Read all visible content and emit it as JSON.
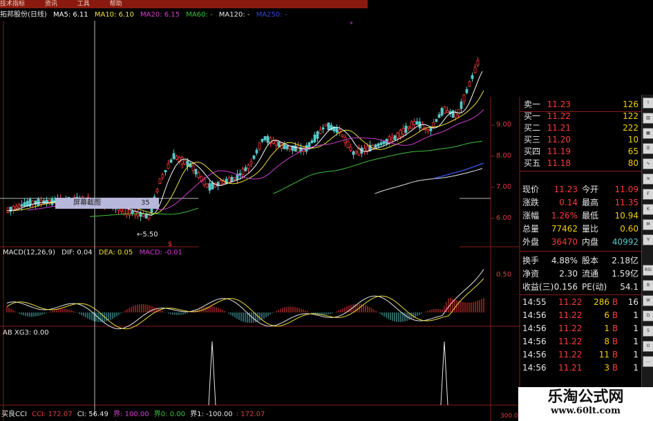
{
  "menu": [
    "技术指标",
    "资讯",
    "工具",
    "帮助"
  ],
  "header": {
    "stock": "拓邦股份(日线)",
    "ma5": "MA5: 6.11",
    "ma10": "MA10: 6.10",
    "ma20": "MA20: 6.15",
    "ma60": "MA60: -",
    "ma120": "MA120: -",
    "ma250": "MA250: -"
  },
  "colors": {
    "up": "#ff3a3a",
    "down": "#55c8c8",
    "ma5": "#ffffff",
    "ma10": "#f0e040",
    "ma20": "#d040d0",
    "ma60": "#40c040",
    "ma120": "#e8e8e8",
    "ma250": "#3048c8",
    "grid": "#8a1d1d"
  },
  "price_axis": [
    "9.00",
    "8.00",
    "7.00",
    "6.00"
  ],
  "macd_axis": [
    "0.50"
  ],
  "cci_axis": [
    "300.00"
  ],
  "low_marker": "5.50",
  "screenshot_tip": {
    "label": "屏幕截图",
    "value": "35"
  },
  "macd_header": {
    "name": "MACD(12,26,9)",
    "dif": "DIF: 0.04",
    "dea": "DEA: 0.05",
    "macd": "MACD: -0.01"
  },
  "xg_header": "AB XG3: 0.00",
  "cci_header": {
    "name": "买良CCI",
    "cci": "CCI: 172.07",
    "ci": "CI: 56.49",
    "jie": "界: 100.00",
    "jie0": "界0: 0.00",
    "jie1": "界1: -100.00",
    "last": ": 172.07"
  },
  "orderbook": [
    {
      "label": "卖一",
      "price": "11.23",
      "vol": "126"
    },
    {
      "label": "买一",
      "price": "11.22",
      "vol": "122"
    },
    {
      "label": "买二",
      "price": "11.21",
      "vol": "222"
    },
    {
      "label": "买三",
      "price": "11.20",
      "vol": "10"
    },
    {
      "label": "买四",
      "price": "11.19",
      "vol": "65"
    },
    {
      "label": "买五",
      "price": "11.18",
      "vol": "80"
    }
  ],
  "quote": [
    {
      "l1": "现价",
      "v1": "11.23",
      "c1": "#ff3a3a",
      "l2": "今开",
      "v2": "11.09",
      "c2": "#ff3a3a"
    },
    {
      "l1": "涨跌",
      "v1": "0.14",
      "c1": "#ff3a3a",
      "l2": "最高",
      "v2": "11.35",
      "c2": "#ff3a3a"
    },
    {
      "l1": "涨幅",
      "v1": "1.26%",
      "c1": "#ff3a3a",
      "l2": "最低",
      "v2": "10.94",
      "c2": "#f2d200"
    },
    {
      "l1": "总量",
      "v1": "77462",
      "c1": "#f2d200",
      "l2": "量比",
      "v2": "0.60",
      "c2": "#f2d200"
    },
    {
      "l1": "外盘",
      "v1": "36470",
      "c1": "#ff3a3a",
      "l2": "内盘",
      "v2": "40992",
      "c2": "#55c8c8"
    }
  ],
  "fundamentals": [
    {
      "l1": "换手",
      "v1": "4.88%",
      "l2": "股本",
      "v2": "2.18亿"
    },
    {
      "l1": "净资",
      "v1": "2.30",
      "l2": "流通",
      "v2": "1.59亿"
    },
    {
      "l1": "收益(三)",
      "v1": "0.156",
      "l2": "PE(动)",
      "v2": "54.1"
    }
  ],
  "trades": [
    {
      "time": "14:55",
      "price": "11.22",
      "vol": "286",
      "side": "B",
      "n": "16"
    },
    {
      "time": "14:56",
      "price": "11.22",
      "vol": "6",
      "side": "B",
      "n": "1"
    },
    {
      "time": "14:56",
      "price": "11.22",
      "vol": "1",
      "side": "B",
      "n": "1"
    },
    {
      "time": "14:56",
      "price": "11.22",
      "vol": "8",
      "side": "B",
      "n": "1"
    },
    {
      "time": "14:56",
      "price": "11.22",
      "vol": "11",
      "side": "B",
      "n": "1"
    },
    {
      "time": "14:56",
      "price": "11.21",
      "vol": "3",
      "side": "B",
      "n": "1"
    }
  ],
  "watermark": {
    "title": "乐淘公式网",
    "url": "www.60lt.com"
  }
}
